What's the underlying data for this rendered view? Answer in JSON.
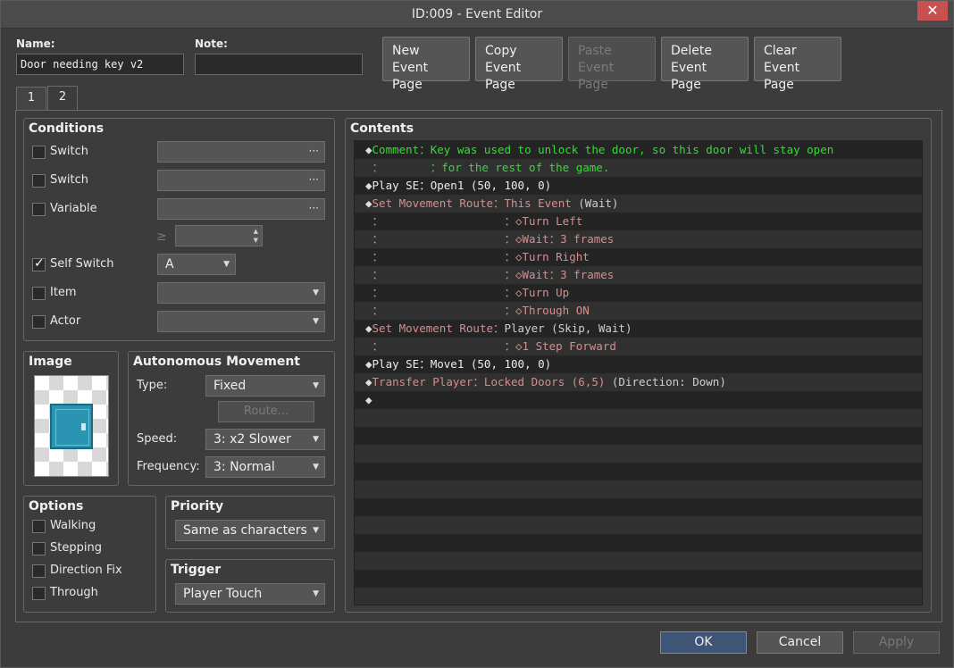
{
  "window": {
    "title": "ID:009 - Event Editor",
    "close_glyph": "✕"
  },
  "header": {
    "name_label": "Name:",
    "name_value": "Door needing key v2",
    "note_label": "Note:",
    "note_value": ""
  },
  "page_buttons": [
    {
      "line1": "New",
      "line2": "Event Page",
      "enabled": true
    },
    {
      "line1": "Copy",
      "line2": "Event Page",
      "enabled": true
    },
    {
      "line1": "Paste",
      "line2": "Event Page",
      "enabled": false
    },
    {
      "line1": "Delete",
      "line2": "Event Page",
      "enabled": true
    },
    {
      "line1": "Clear",
      "line2": "Event Page",
      "enabled": true
    }
  ],
  "tabs": [
    {
      "label": "1"
    },
    {
      "label": "2",
      "active": true
    }
  ],
  "conditions": {
    "title": "Conditions",
    "switch1_label": "Switch",
    "switch2_label": "Switch",
    "variable_label": "Variable",
    "gte_glyph": "≥",
    "self_switch_label": "Self Switch",
    "self_switch_value": "A",
    "item_label": "Item",
    "actor_label": "Actor",
    "dots": "···"
  },
  "image": {
    "title": "Image"
  },
  "autonomous": {
    "title": "Autonomous Movement",
    "type_label": "Type:",
    "type_value": "Fixed",
    "route_button": "Route...",
    "speed_label": "Speed:",
    "speed_value": "3: x2 Slower",
    "frequency_label": "Frequency:",
    "frequency_value": "3: Normal"
  },
  "options": {
    "title": "Options",
    "walking": "Walking",
    "stepping": "Stepping",
    "direction_fix": "Direction Fix",
    "through": "Through"
  },
  "priority": {
    "title": "Priority",
    "value": "Same as characters"
  },
  "trigger": {
    "title": "Trigger",
    "value": "Player Touch"
  },
  "contents": {
    "title": "Contents",
    "lines": [
      {
        "parts": [
          {
            "t": "◆",
            "c": "c-mark"
          },
          {
            "t": "Comment：Key was used to unlock the door, so this door will stay open",
            "c": "c-green"
          }
        ]
      },
      {
        "parts": [
          {
            "t": " ：       ：for the rest of the game.",
            "c": "c-green"
          }
        ]
      },
      {
        "parts": [
          {
            "t": "◆",
            "c": "c-mark"
          },
          {
            "t": "Play SE：Open1 (50, 100, 0)",
            "c": "c-white"
          }
        ]
      },
      {
        "parts": [
          {
            "t": "◆",
            "c": "c-mark"
          },
          {
            "t": "Set Movement Route：This Event ",
            "c": "c-red"
          },
          {
            "t": "(Wait)",
            "c": "c-gray"
          }
        ]
      },
      {
        "parts": [
          {
            "t": " ：                  ：◇Turn Left",
            "c": "c-red"
          }
        ]
      },
      {
        "parts": [
          {
            "t": " ：                  ：◇Wait：3 frames",
            "c": "c-red"
          }
        ]
      },
      {
        "parts": [
          {
            "t": " ：                  ：◇Turn Right",
            "c": "c-red"
          }
        ]
      },
      {
        "parts": [
          {
            "t": " ：                  ：◇Wait：3 frames",
            "c": "c-red"
          }
        ]
      },
      {
        "parts": [
          {
            "t": " ：                  ：◇Turn Up",
            "c": "c-red"
          }
        ]
      },
      {
        "parts": [
          {
            "t": " ：                  ：◇Through ON",
            "c": "c-red"
          }
        ]
      },
      {
        "parts": [
          {
            "t": "◆",
            "c": "c-mark"
          },
          {
            "t": "Set Movement Route：",
            "c": "c-red"
          },
          {
            "t": "Player (Skip, Wait)",
            "c": "c-gray"
          }
        ]
      },
      {
        "parts": [
          {
            "t": " ：                  ：◇1 Step Forward",
            "c": "c-red"
          }
        ]
      },
      {
        "parts": [
          {
            "t": "◆",
            "c": "c-mark"
          },
          {
            "t": "Play SE：Move1 (50, 100, 0)",
            "c": "c-white"
          }
        ]
      },
      {
        "parts": [
          {
            "t": "◆",
            "c": "c-mark"
          },
          {
            "t": "Transfer Player：Locked Doors (6,5) ",
            "c": "c-red"
          },
          {
            "t": "(Direction: Down)",
            "c": "c-gray"
          }
        ]
      },
      {
        "parts": [
          {
            "t": "◆",
            "c": "c-mark"
          }
        ]
      }
    ],
    "total_rows": 26
  },
  "footer": {
    "ok": "OK",
    "cancel": "Cancel",
    "apply": "Apply"
  }
}
